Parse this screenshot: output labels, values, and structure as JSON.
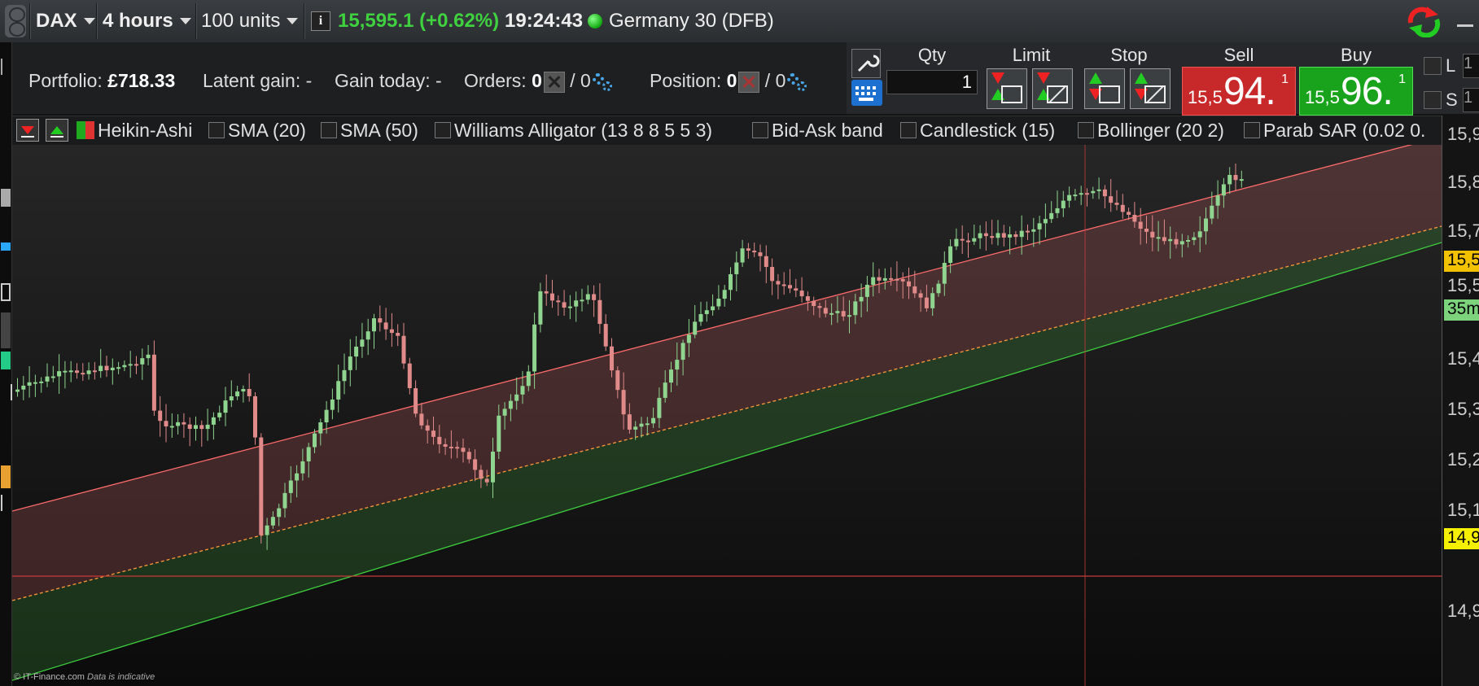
{
  "toolbar": {
    "instrument": "DAX",
    "timeframe": "4 hours",
    "units": "100 units",
    "last_price": "15,595.1 (+0.62%)",
    "time": "19:24:43",
    "market_name": "Germany 30 (DFB)"
  },
  "portfolio": {
    "portfolio_label": "Portfolio:",
    "portfolio_value": "£718.33",
    "latent_gain": "Latent gain: -",
    "gain_today": "Gain today: -",
    "orders_label": "Orders:",
    "orders_a": "0",
    "orders_b": "/ 0",
    "position_label": "Position:",
    "position_a": "0",
    "position_b": "/ 0"
  },
  "order_panel": {
    "qty_label": "Qty",
    "qty_value": "1",
    "limit_label": "Limit",
    "stop_label": "Stop",
    "sell_label": "Sell",
    "buy_label": "Buy",
    "sell_prefix": "15,5",
    "sell_big": "94.",
    "sell_sup": "1",
    "buy_prefix": "15,5",
    "buy_big": "96.",
    "buy_sup": "1",
    "l_label": "L",
    "s_label": "S",
    "l_value": "1",
    "s_value": "1"
  },
  "indicators": [
    "Heikin-Ashi",
    "SMA (20)",
    "SMA (50)",
    "Williams Alligator (13 8 8 5 5 3)",
    "Bid-Ask band",
    "Candlestick (15)",
    "Bollinger (20 2)",
    "Parab SAR (0.02 0."
  ],
  "axis": {
    "labels": [
      "15,9",
      "15,8",
      "15,7",
      "15,5",
      "15,4",
      "15,3",
      "15,2",
      "15,1",
      "14,9"
    ],
    "price_tag": "15,5",
    "countdown_tag": "35m",
    "hline_tag": "14,9"
  },
  "footer": {
    "copyright": "© IT-Finance.com",
    "note": "Data is indicative"
  },
  "colors": {
    "bull": "#8fd48f",
    "bear": "#e08a8a",
    "upper_band": "#ff6b6b",
    "lower_band": "#3fcf3f",
    "mid_band": "#ff9a3c",
    "hline": "#c83a3a"
  }
}
